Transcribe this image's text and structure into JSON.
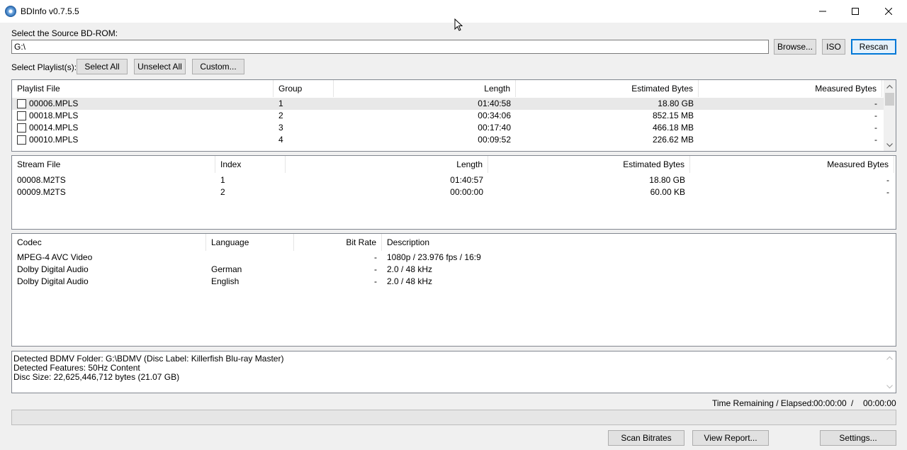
{
  "window": {
    "title": "BDInfo v0.7.5.5"
  },
  "source": {
    "label": "Select the Source BD-ROM:",
    "path_value": "G:\\",
    "browse_label": "Browse...",
    "iso_label": "ISO",
    "rescan_label": "Rescan"
  },
  "playlist_controls": {
    "label": "Select Playlist(s):",
    "select_all_label": "Select All",
    "unselect_all_label": "Unselect All",
    "custom_label": "Custom..."
  },
  "playlists": {
    "columns": [
      "Playlist File",
      "Group",
      "Length",
      "Estimated Bytes",
      "Measured Bytes"
    ],
    "rows": [
      {
        "file": "00006.MPLS",
        "group": "1",
        "length": "01:40:58",
        "estimated": "18.80 GB",
        "measured": "-"
      },
      {
        "file": "00018.MPLS",
        "group": "2",
        "length": "00:34:06",
        "estimated": "852.15 MB",
        "measured": "-"
      },
      {
        "file": "00014.MPLS",
        "group": "3",
        "length": "00:17:40",
        "estimated": "466.18 MB",
        "measured": "-"
      },
      {
        "file": "00010.MPLS",
        "group": "4",
        "length": "00:09:52",
        "estimated": "226.62 MB",
        "measured": "-"
      }
    ]
  },
  "streams": {
    "columns": [
      "Stream File",
      "Index",
      "Length",
      "Estimated Bytes",
      "Measured Bytes"
    ],
    "rows": [
      {
        "file": "00008.M2TS",
        "index": "1",
        "length": "01:40:57",
        "estimated": "18.80 GB",
        "measured": "-"
      },
      {
        "file": "00009.M2TS",
        "index": "2",
        "length": "00:00:00",
        "estimated": "60.00 KB",
        "measured": "-"
      }
    ]
  },
  "codecs": {
    "columns": [
      "Codec",
      "Language",
      "Bit Rate",
      "Description"
    ],
    "rows": [
      {
        "codec": "MPEG-4 AVC Video",
        "language": "",
        "bitrate": "-",
        "description": "1080p / 23.976 fps / 16:9"
      },
      {
        "codec": "Dolby Digital Audio",
        "language": "German",
        "bitrate": "-",
        "description": "2.0 / 48 kHz"
      },
      {
        "codec": "Dolby Digital Audio",
        "language": "English",
        "bitrate": "-",
        "description": "2.0 / 48 kHz"
      }
    ]
  },
  "log": {
    "lines": [
      "Detected BDMV Folder: G:\\BDMV (Disc Label: Killerfish Blu-ray Master)",
      "Detected Features: 50Hz Content",
      "Disc Size: 22,625,446,712 bytes (21.07 GB)"
    ]
  },
  "status": {
    "time_label": "Time Remaining / Elapsed:",
    "remaining": "00:00:00",
    "separator": "/",
    "elapsed": "00:00:00",
    "progress_fraction": 0
  },
  "footer": {
    "scan_label": "Scan Bitrates",
    "report_label": "View Report...",
    "settings_label": "Settings..."
  },
  "icons": {
    "app": "bluray-disc-icon",
    "minimize": "minimize-icon",
    "maximize": "maximize-icon",
    "close": "close-icon"
  },
  "colors": {
    "accent": "#0078d7",
    "selection": "#e8e8e8"
  }
}
